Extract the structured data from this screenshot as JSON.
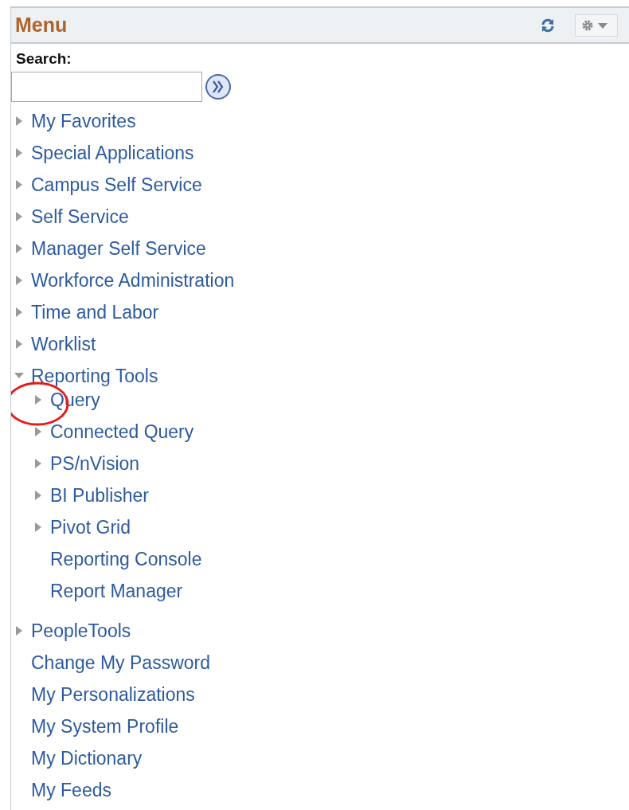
{
  "panel": {
    "title": "Menu"
  },
  "search": {
    "label": "Search:"
  },
  "tree": [
    {
      "label": "My Favorites",
      "kind": "folder",
      "expanded": false
    },
    {
      "label": "Special Applications",
      "kind": "folder",
      "expanded": false
    },
    {
      "label": "Campus Self Service",
      "kind": "folder",
      "expanded": false
    },
    {
      "label": "Self Service",
      "kind": "folder",
      "expanded": false
    },
    {
      "label": "Manager Self Service",
      "kind": "folder",
      "expanded": false
    },
    {
      "label": "Workforce Administration",
      "kind": "folder",
      "expanded": false
    },
    {
      "label": "Time and Labor",
      "kind": "folder",
      "expanded": false
    },
    {
      "label": "Worklist",
      "kind": "folder",
      "expanded": false
    },
    {
      "label": "Reporting Tools",
      "kind": "folder",
      "expanded": true,
      "children": [
        {
          "label": "Query",
          "kind": "folder",
          "expanded": false
        },
        {
          "label": "Connected Query",
          "kind": "folder",
          "expanded": false
        },
        {
          "label": "PS/nVision",
          "kind": "folder",
          "expanded": false
        },
        {
          "label": "BI Publisher",
          "kind": "folder",
          "expanded": false
        },
        {
          "label": "Pivot Grid",
          "kind": "folder",
          "expanded": false
        },
        {
          "label": "Reporting Console",
          "kind": "link"
        },
        {
          "label": "Report Manager",
          "kind": "link"
        }
      ]
    },
    {
      "label": "PeopleTools",
      "kind": "folder",
      "expanded": false
    },
    {
      "label": "Change My Password",
      "kind": "link"
    },
    {
      "label": "My Personalizations",
      "kind": "link"
    },
    {
      "label": "My System Profile",
      "kind": "link"
    },
    {
      "label": "My Dictionary",
      "kind": "link"
    },
    {
      "label": "My Feeds",
      "kind": "link"
    }
  ]
}
